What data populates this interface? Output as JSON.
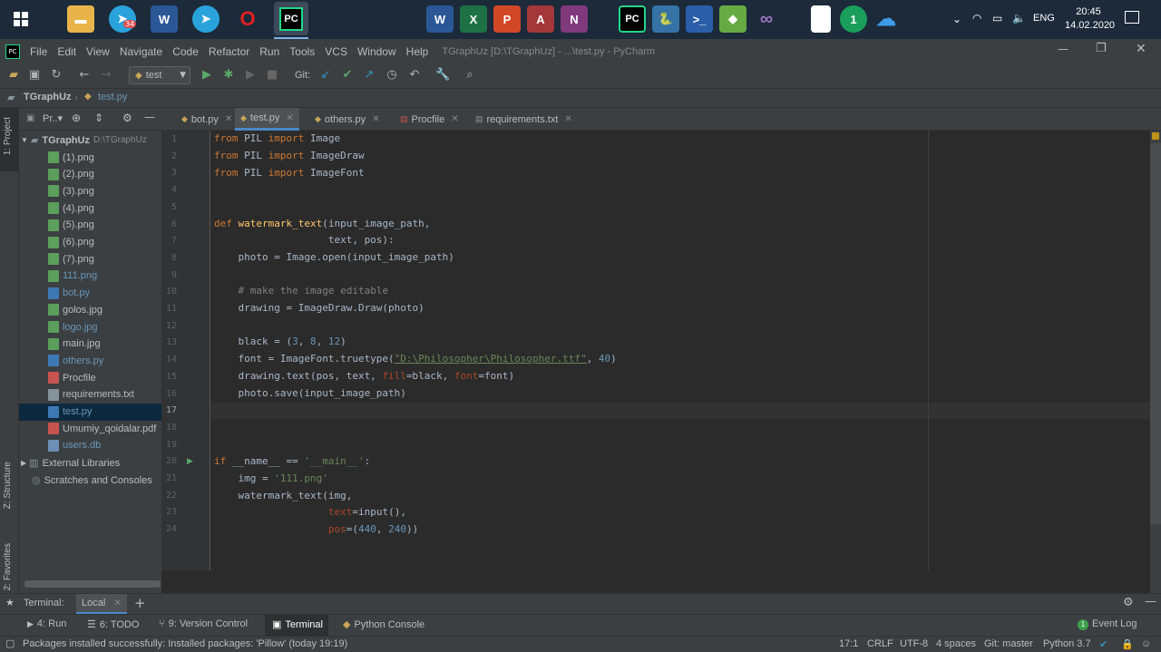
{
  "taskbar": {
    "clock_time": "20:45",
    "clock_date": "14.02.2020",
    "language": "ENG",
    "telegram_badge": "34"
  },
  "window": {
    "title": "TGraphUz [D:\\TGraphUz] - ...\\test.py - PyCharm",
    "menu": [
      "File",
      "Edit",
      "View",
      "Navigate",
      "Code",
      "Refactor",
      "Run",
      "Tools",
      "VCS",
      "Window",
      "Help"
    ]
  },
  "toolbar": {
    "run_config": "test",
    "git_label": "Git:"
  },
  "breadcrumb": {
    "project": "TGraphUz",
    "file": "test.py"
  },
  "project_panel": {
    "header": "Pr..▾",
    "root_name": "TGraphUz",
    "root_path": "D:\\TGraphUz",
    "files": [
      {
        "name": "(1).png",
        "type": "png"
      },
      {
        "name": "(2).png",
        "type": "png"
      },
      {
        "name": "(3).png",
        "type": "png"
      },
      {
        "name": "(4).png",
        "type": "png"
      },
      {
        "name": "(5).png",
        "type": "png"
      },
      {
        "name": "(6).png",
        "type": "png"
      },
      {
        "name": "(7).png",
        "type": "png"
      },
      {
        "name": "111.png",
        "type": "png"
      },
      {
        "name": "bot.py",
        "type": "py"
      },
      {
        "name": "golos.jpg",
        "type": "png"
      },
      {
        "name": "logo.jpg",
        "type": "png"
      },
      {
        "name": "main.jpg",
        "type": "png"
      },
      {
        "name": "others.py",
        "type": "py"
      },
      {
        "name": "Procfile",
        "type": "proc"
      },
      {
        "name": "requirements.txt",
        "type": "txt"
      },
      {
        "name": "test.py",
        "type": "py"
      },
      {
        "name": "Umumiy_qoidalar.pdf",
        "type": "pdf"
      },
      {
        "name": "users.db",
        "type": "db"
      }
    ],
    "external_libraries": "External Libraries",
    "scratches": "Scratches and Consoles"
  },
  "side_labels": {
    "project": "1: Project",
    "structure": "Z: Structure",
    "favorites": "2: Favorites"
  },
  "tabs": [
    {
      "label": "bot.py",
      "active": false
    },
    {
      "label": "test.py",
      "active": true
    },
    {
      "label": "others.py",
      "active": false
    },
    {
      "label": "Procfile",
      "active": false
    },
    {
      "label": "requirements.txt",
      "active": false
    }
  ],
  "code_lines": [
    "1",
    "2",
    "3",
    "4",
    "5",
    "6",
    "7",
    "8",
    "9",
    "10",
    "11",
    "12",
    "13",
    "14",
    "15",
    "16",
    "17",
    "18",
    "19",
    "20",
    "21",
    "22",
    "23",
    "24"
  ],
  "terminal": {
    "label": "Terminal:",
    "tab": "Local"
  },
  "bottom_tabs": {
    "run": "4: Run",
    "todo": "6: TODO",
    "vcs": "9: Version Control",
    "terminal": "Terminal",
    "python_console": "Python Console",
    "event_log": "Event Log",
    "event_count": "1"
  },
  "status": {
    "message": "Packages installed successfully: Installed packages: 'Pillow' (today 19:19)",
    "position": "17:1",
    "line_sep": "CRLF",
    "encoding": "UTF-8",
    "indent": "4 spaces",
    "git": "Git: master",
    "interpreter": "Python 3.7"
  }
}
